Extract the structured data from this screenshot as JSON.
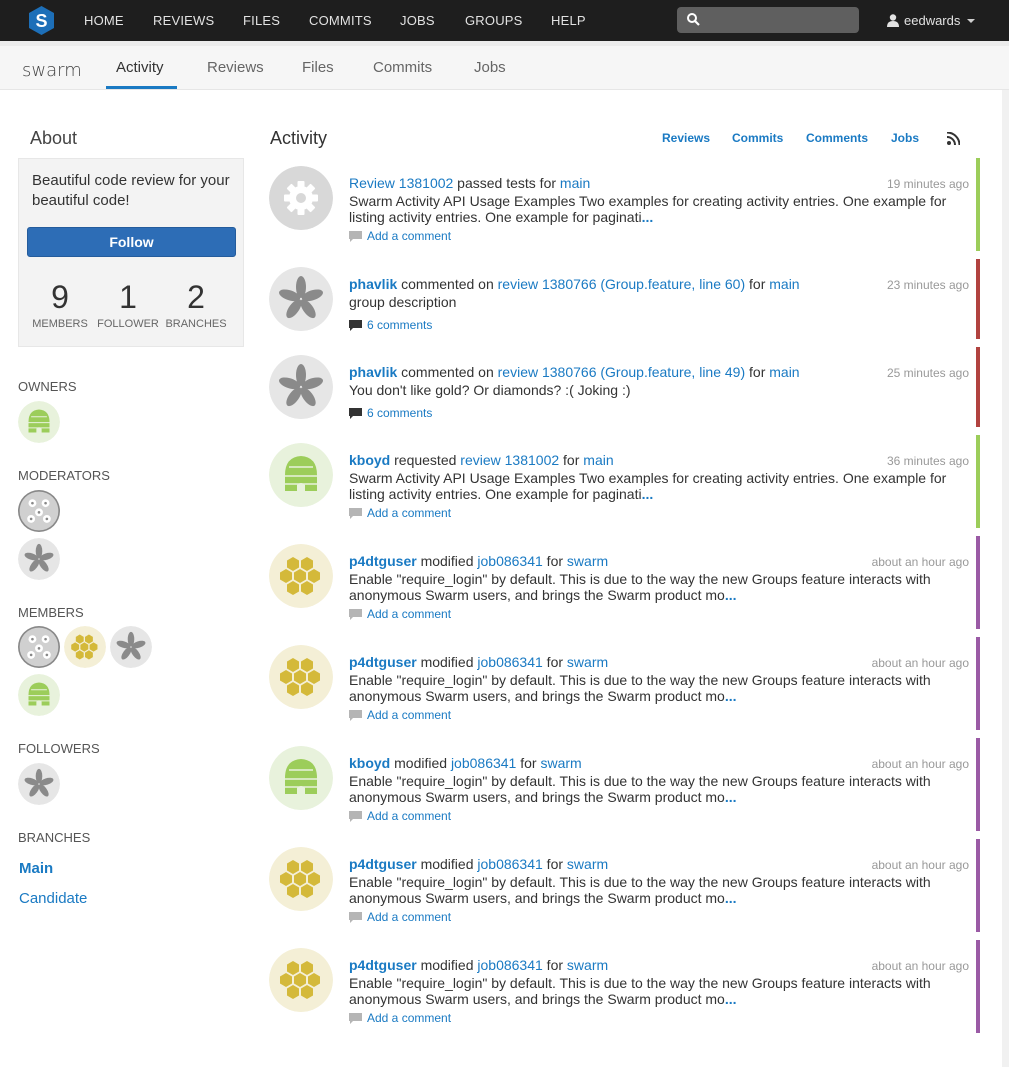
{
  "nav": {
    "items": [
      "HOME",
      "REVIEWS",
      "FILES",
      "COMMITS",
      "JOBS",
      "GROUPS",
      "HELP"
    ],
    "search_placeholder": "",
    "user": "eedwards"
  },
  "subnav": {
    "brand": "swarm",
    "tabs": [
      "Activity",
      "Reviews",
      "Files",
      "Commits",
      "Jobs"
    ],
    "active_tab": "Activity"
  },
  "sidebar": {
    "about_title": "About",
    "description": "Beautiful code review for your beautiful code!",
    "follow_label": "Follow",
    "stats": [
      {
        "num": "9",
        "label": "MEMBERS"
      },
      {
        "num": "1",
        "label": "FOLLOWER"
      },
      {
        "num": "2",
        "label": "BRANCHES"
      }
    ],
    "owners_label": "OWNERS",
    "moderators_label": "MODERATORS",
    "members_label": "MEMBERS",
    "followers_label": "FOLLOWERS",
    "branches_label": "BRANCHES",
    "branches": [
      "Main",
      "Candidate"
    ]
  },
  "activity": {
    "title": "Activity",
    "filters": [
      "Reviews",
      "Commits",
      "Comments",
      "Jobs"
    ],
    "entries": [
      {
        "avatar": "gear",
        "user": "",
        "target": "Review 1381002",
        "action": " passed tests for ",
        "project": "main",
        "time": "19 minutes ago",
        "body": "Swarm Activity API Usage Examples Two examples for creating activity entries. One example for listing activity entries. One example for paginati",
        "more": "...",
        "comment": "Add a comment",
        "comment_type": "add",
        "status_color": "#9ccd5a"
      },
      {
        "avatar": "pinwheel",
        "user": "phavlik",
        "action": " commented on ",
        "target": "review 1380766 (Group.feature, line 60)",
        "for_word": " for ",
        "project": "main",
        "time": "23 minutes ago",
        "body": "group description",
        "more": "",
        "comment": "6 comments",
        "comment_type": "count",
        "status_color": "#b1423f"
      },
      {
        "avatar": "pinwheel",
        "user": "phavlik",
        "action": " commented on ",
        "target": "review 1380766 (Group.feature, line 49)",
        "for_word": " for ",
        "project": "main",
        "time": "25 minutes ago",
        "body": "You don't like gold? Or diamonds? :( Joking :)",
        "more": "",
        "comment": "6 comments",
        "comment_type": "count",
        "status_color": "#b1423f"
      },
      {
        "avatar": "hive",
        "user": "kboyd",
        "action": " requested ",
        "target": "review 1381002",
        "for_word": " for ",
        "project": "main",
        "time": "36 minutes ago",
        "body": "Swarm Activity API Usage Examples Two examples for creating activity entries. One example for listing activity entries. One example for paginati",
        "more": "...",
        "comment": "Add a comment",
        "comment_type": "add",
        "status_color": "#9ccd5a"
      },
      {
        "avatar": "honeycomb",
        "user": "p4dtguser",
        "action": " modified ",
        "target": "job086341",
        "for_word": " for ",
        "project": "swarm",
        "time": "about an hour ago",
        "body": "Enable \"require_login\" by default. This is due to the way the new Groups feature interacts with anonymous Swarm users, and brings the Swarm product mo",
        "more": "...",
        "comment": "Add a comment",
        "comment_type": "add",
        "status_color": "#9a5aa5"
      },
      {
        "avatar": "honeycomb",
        "user": "p4dtguser",
        "action": " modified ",
        "target": "job086341",
        "for_word": " for ",
        "project": "swarm",
        "time": "about an hour ago",
        "body": "Enable \"require_login\" by default. This is due to the way the new Groups feature interacts with anonymous Swarm users, and brings the Swarm product mo",
        "more": "...",
        "comment": "Add a comment",
        "comment_type": "add",
        "status_color": "#9a5aa5"
      },
      {
        "avatar": "hive",
        "user": "kboyd",
        "action": " modified ",
        "target": "job086341",
        "for_word": " for ",
        "project": "swarm",
        "time": "about an hour ago",
        "body": "Enable \"require_login\" by default. This is due to the way the new Groups feature interacts with anonymous Swarm users, and brings the Swarm product mo",
        "more": "...",
        "comment": "Add a comment",
        "comment_type": "add",
        "status_color": "#9a5aa5"
      },
      {
        "avatar": "honeycomb",
        "user": "p4dtguser",
        "action": " modified ",
        "target": "job086341",
        "for_word": " for ",
        "project": "swarm",
        "time": "about an hour ago",
        "body": "Enable \"require_login\" by default. This is due to the way the new Groups feature interacts with anonymous Swarm users, and brings the Swarm product mo",
        "more": "...",
        "comment": "Add a comment",
        "comment_type": "add",
        "status_color": "#9a5aa5"
      },
      {
        "avatar": "honeycomb",
        "user": "p4dtguser",
        "action": " modified ",
        "target": "job086341",
        "for_word": " for ",
        "project": "swarm",
        "time": "about an hour ago",
        "body": "Enable \"require_login\" by default. This is due to the way the new Groups feature interacts with anonymous Swarm users, and brings the Swarm product mo",
        "more": "...",
        "comment": "Add a comment",
        "comment_type": "add",
        "status_color": "#9a5aa5"
      }
    ]
  }
}
